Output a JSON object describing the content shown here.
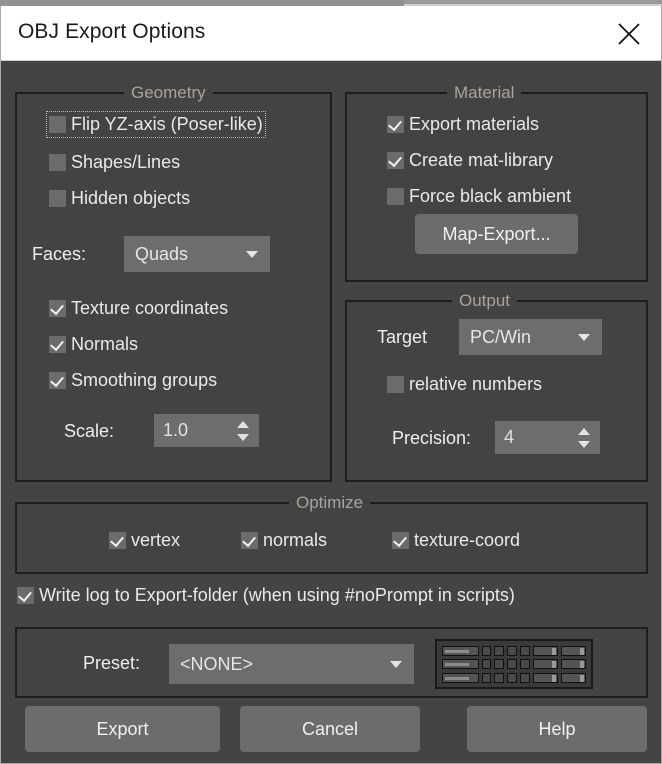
{
  "window": {
    "title": "OBJ Export Options",
    "close_icon": "close-x-icon",
    "background_color": "#444444",
    "titlebar_color": "#ffffff"
  },
  "geometry": {
    "legend": "Geometry",
    "checkboxes": [
      {
        "label": "Flip YZ-axis (Poser-like)",
        "checked": false,
        "focused": true
      },
      {
        "label": "Shapes/Lines",
        "checked": false,
        "focused": false
      },
      {
        "label": "Hidden objects",
        "checked": false,
        "focused": false
      },
      {
        "label": "Texture coordinates",
        "checked": true,
        "focused": false
      },
      {
        "label": "Normals",
        "checked": true,
        "focused": false
      },
      {
        "label": "Smoothing groups",
        "checked": true,
        "focused": false
      }
    ],
    "faces_label": "Faces:",
    "faces_value": "Quads",
    "scale_label": "Scale:",
    "scale_value": "1.0"
  },
  "material": {
    "legend": "Material",
    "checkboxes": [
      {
        "label": "Export materials",
        "checked": true
      },
      {
        "label": "Create mat-library",
        "checked": true
      },
      {
        "label": "Force black ambient",
        "checked": false
      }
    ],
    "map_export_label": "Map-Export..."
  },
  "output": {
    "legend": "Output",
    "target_label": "Target",
    "target_value": "PC/Win",
    "relative_numbers_label": "relative numbers",
    "relative_numbers_checked": false,
    "precision_label": "Precision:",
    "precision_value": "4"
  },
  "optimize": {
    "legend": "Optimize",
    "checkboxes": [
      {
        "label": "vertex",
        "checked": true
      },
      {
        "label": "normals",
        "checked": true
      },
      {
        "label": "texture-coord",
        "checked": true
      }
    ]
  },
  "write_log": {
    "label": "Write log to Export-folder (when using #noPrompt in scripts)",
    "checked": true
  },
  "preset": {
    "label": "Preset:",
    "value": "<NONE>",
    "panel_icon": "control-panel-icon"
  },
  "buttons": {
    "export": "Export",
    "cancel": "Cancel",
    "help": "Help"
  }
}
